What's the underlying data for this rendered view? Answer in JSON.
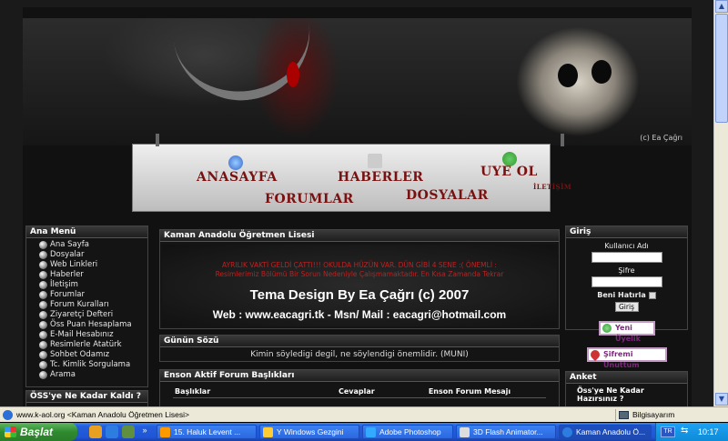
{
  "banner": {
    "credit": "(c) Ea Çağrı"
  },
  "nav": {
    "items": [
      "ANASAYFA",
      "HABERLER",
      "UYE OL",
      "İLETİŞİM",
      "FORUMLAR",
      "DOSYALAR"
    ]
  },
  "left_menu": {
    "title": "Ana Menü",
    "items": [
      "Ana Sayfa",
      "Dosyalar",
      "Web Linkleri",
      "Haberler",
      "İletişim",
      "Forumlar",
      "Forum Kuralları",
      "Ziyaretçi Defteri",
      "Öss Puan Hesaplama",
      "E-Mail Hesabınız",
      "Resimlerle Atatürk",
      "Sohbet Odamız",
      "Tc. Kimlik Sorgulama",
      "Arama"
    ]
  },
  "oss_panel": {
    "title": "ÖSS'ye Ne Kadar Kaldı ?"
  },
  "main": {
    "title": "Kaman Anadolu Öğretmen Lisesi",
    "warning_line1": "AYRILIK VAKTİ GELDİ ÇATTI!!! OKULDA HÜZÜN VAR. DÜN GİBİ 4 SENE :( ÖNEMLİ :",
    "warning_line2": "Resimlerimiz Bölümü Bir Sorun Nedeniyle Çalışmamaktadır. En Kısa Zamanda Tekrar",
    "design": "Tema Design By Ea Çağrı (c) 2007",
    "contact": "Web : www.eacagri.tk  - Msn/ Mail : eacagri@hotmail.com"
  },
  "soz": {
    "title": "Günün Sözü",
    "quote": "Kimin söyledigi degil, ne söylendigi önemlidir. (MUNI)"
  },
  "forum": {
    "title": "Enson Aktif Forum Başlıkları",
    "headers": [
      "Başlıklar",
      "Cevaplar",
      "Enson Forum Mesajı"
    ]
  },
  "login": {
    "title": "Giriş",
    "username_label": "Kullanıcı Adı",
    "password_label": "Şifre",
    "remember_label": "Beni Hatırla",
    "submit_label": "Giriş"
  },
  "new_member_label": "Yeni Üyelik",
  "forgot_label": "Şifremi Unuttum",
  "anket": {
    "title": "Anket",
    "question_line1": "Öss'ye Ne Kadar",
    "question_line2": "Hazırsınız ?"
  },
  "statusbar": {
    "text": "www.k-aol.org <Kaman Anadolu Öğretmen Lisesi>",
    "zone": "Bilgisayarım"
  },
  "taskbar": {
    "start_label": "Başlat",
    "tasks": [
      "15. Haluk Levent ...",
      "Y Windows Gezgini",
      "Adobe Photoshop",
      "3D Flash Animator...",
      "Kaman Anadolu Ö..."
    ],
    "lang": "TR",
    "clock": "10:17"
  },
  "colors": {
    "nav_text": "#7a1010",
    "warning": "#b22222",
    "taskbar": "#245edc",
    "start": "#2f8b2f"
  }
}
